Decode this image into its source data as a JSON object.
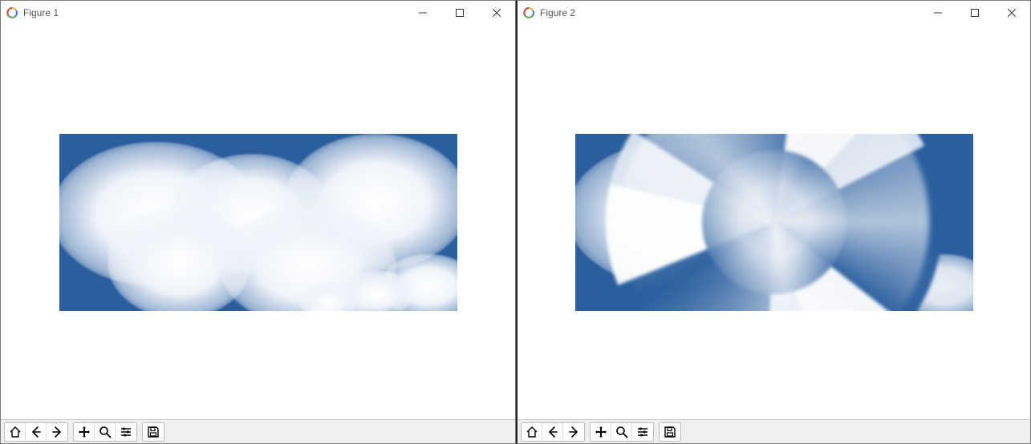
{
  "windows": [
    {
      "title": "Figure 1",
      "toolbar": {
        "home": "Reset original view",
        "back": "Back to previous view",
        "forward": "Forward to next view",
        "pan": "Pan axes",
        "zoom": "Zoom to rectangle",
        "config": "Configure subplots",
        "save": "Save the figure"
      }
    },
    {
      "title": "Figure 2",
      "toolbar": {
        "home": "Reset original view",
        "back": "Back to previous view",
        "forward": "Forward to next view",
        "pan": "Pan axes",
        "zoom": "Zoom to rectangle",
        "config": "Configure subplots",
        "save": "Save the figure"
      }
    }
  ],
  "image_description": {
    "figure1": "Photograph of white cumulus clouds against a blue sky",
    "figure2": "Same cloud image with a swirl / twist distortion applied at the center"
  }
}
